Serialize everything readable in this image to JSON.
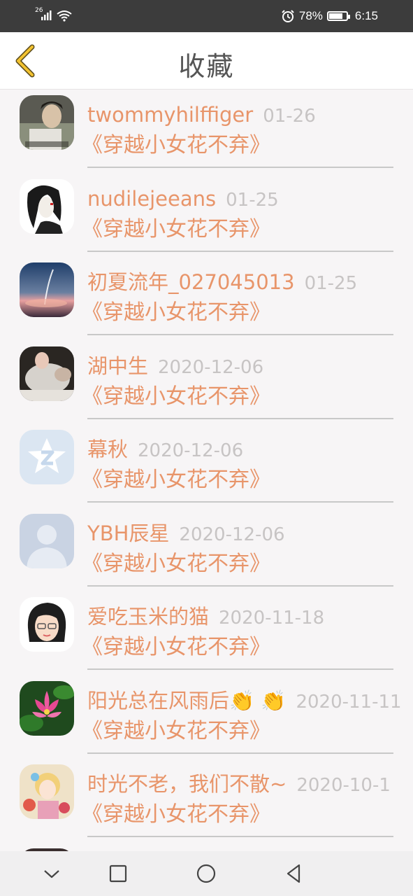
{
  "status_bar": {
    "network": "26",
    "battery": "78%",
    "battery_level": 0.78,
    "time": "6:15"
  },
  "header": {
    "title": "收藏"
  },
  "favorites": [
    {
      "name": "twommyhilffiger",
      "date": "01-26",
      "book": "《穿越小女花不弃》"
    },
    {
      "name": "nudilejeeans",
      "date": "01-25",
      "book": "《穿越小女花不弃》"
    },
    {
      "name": "初夏流年_027045013",
      "date": "01-25",
      "book": "《穿越小女花不弃》"
    },
    {
      "name": "湖中生",
      "date": "2020-12-06",
      "book": "《穿越小女花不弃》"
    },
    {
      "name": "幕秋",
      "date": "2020-12-06",
      "book": "《穿越小女花不弃》"
    },
    {
      "name": "YBH辰星",
      "date": "2020-12-06",
      "book": "《穿越小女花不弃》"
    },
    {
      "name": "爱吃玉米的猫",
      "date": "2020-11-18",
      "book": "《穿越小女花不弃》"
    },
    {
      "name": "阳光总在风雨后👏 👏",
      "date": "2020-11-11",
      "book": "《穿越小女花不弃》"
    },
    {
      "name": "时光不老，我们不散~",
      "date": "2020-10-1",
      "book": "《穿越小女花不弃》"
    }
  ],
  "colors": {
    "accent": "#e8956a",
    "date_gray": "#c7c4c4",
    "back_arrow": "#f2c230"
  }
}
